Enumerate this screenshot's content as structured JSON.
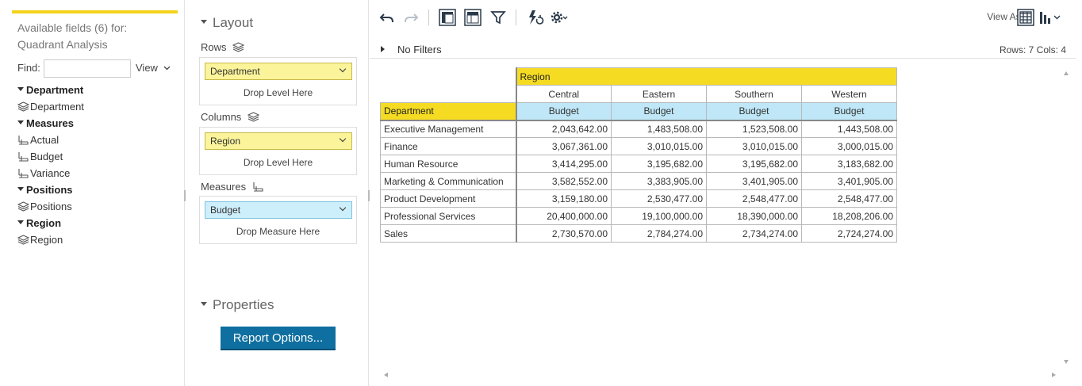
{
  "fields_panel": {
    "title_line1": "Available fields (6) for:",
    "title_line2": "Quadrant Analysis",
    "find_label": "Find:",
    "find_value": "",
    "view_label": "View",
    "groups": [
      {
        "label": "Department",
        "items": [
          {
            "label": "Department",
            "icon": "dimension-icon"
          }
        ]
      },
      {
        "label": "Measures",
        "items": [
          {
            "label": "Actual",
            "icon": "measure-icon"
          },
          {
            "label": "Budget",
            "icon": "measure-icon"
          },
          {
            "label": "Variance",
            "icon": "measure-icon"
          }
        ]
      },
      {
        "label": "Positions",
        "items": [
          {
            "label": "Positions",
            "icon": "dimension-icon"
          }
        ]
      },
      {
        "label": "Region",
        "items": [
          {
            "label": "Region",
            "icon": "dimension-icon"
          }
        ]
      }
    ]
  },
  "layout_panel": {
    "layout_title": "Layout",
    "rows_label": "Rows",
    "rows_chip": "Department",
    "rows_drop": "Drop Level Here",
    "columns_label": "Columns",
    "columns_chip": "Region",
    "columns_drop": "Drop Level Here",
    "measures_label": "Measures",
    "measures_chip": "Budget",
    "measures_drop": "Drop Measure Here",
    "properties_title": "Properties",
    "report_options_label": "Report Options..."
  },
  "toolbar": {
    "view_as_label": "View As:",
    "icons": [
      "undo-icon",
      "redo-icon",
      "layout-icon",
      "table-layout-icon",
      "filter-icon",
      "refresh-icon",
      "settings-icon",
      "grid-view-icon",
      "chart-view-icon"
    ]
  },
  "filter_bar": {
    "label": "No Filters",
    "rows_cols": "Rows: 7  Cols: 4"
  },
  "grid": {
    "region_header": "Region",
    "row_header": "Department",
    "columns": [
      "Central",
      "Eastern",
      "Southern",
      "Western"
    ],
    "measure": "Budget",
    "rows": [
      {
        "label": "Executive Management",
        "values": [
          "2,043,642.00",
          "1,483,508.00",
          "1,523,508.00",
          "1,443,508.00"
        ]
      },
      {
        "label": "Finance",
        "values": [
          "3,067,361.00",
          "3,010,015.00",
          "3,010,015.00",
          "3,000,015.00"
        ]
      },
      {
        "label": "Human Resource",
        "values": [
          "3,414,295.00",
          "3,195,682.00",
          "3,195,682.00",
          "3,183,682.00"
        ]
      },
      {
        "label": "Marketing & Communication",
        "values": [
          "3,582,552.00",
          "3,383,905.00",
          "3,401,905.00",
          "3,401,905.00"
        ]
      },
      {
        "label": "Product Development",
        "values": [
          "3,159,180.00",
          "2,530,477.00",
          "2,548,477.00",
          "2,548,477.00"
        ]
      },
      {
        "label": "Professional Services",
        "values": [
          "20,400,000.00",
          "19,100,000.00",
          "18,390,000.00",
          "18,208,206.00"
        ]
      },
      {
        "label": "Sales",
        "values": [
          "2,730,570.00",
          "2,784,274.00",
          "2,734,274.00",
          "2,724,274.00"
        ]
      }
    ]
  }
}
